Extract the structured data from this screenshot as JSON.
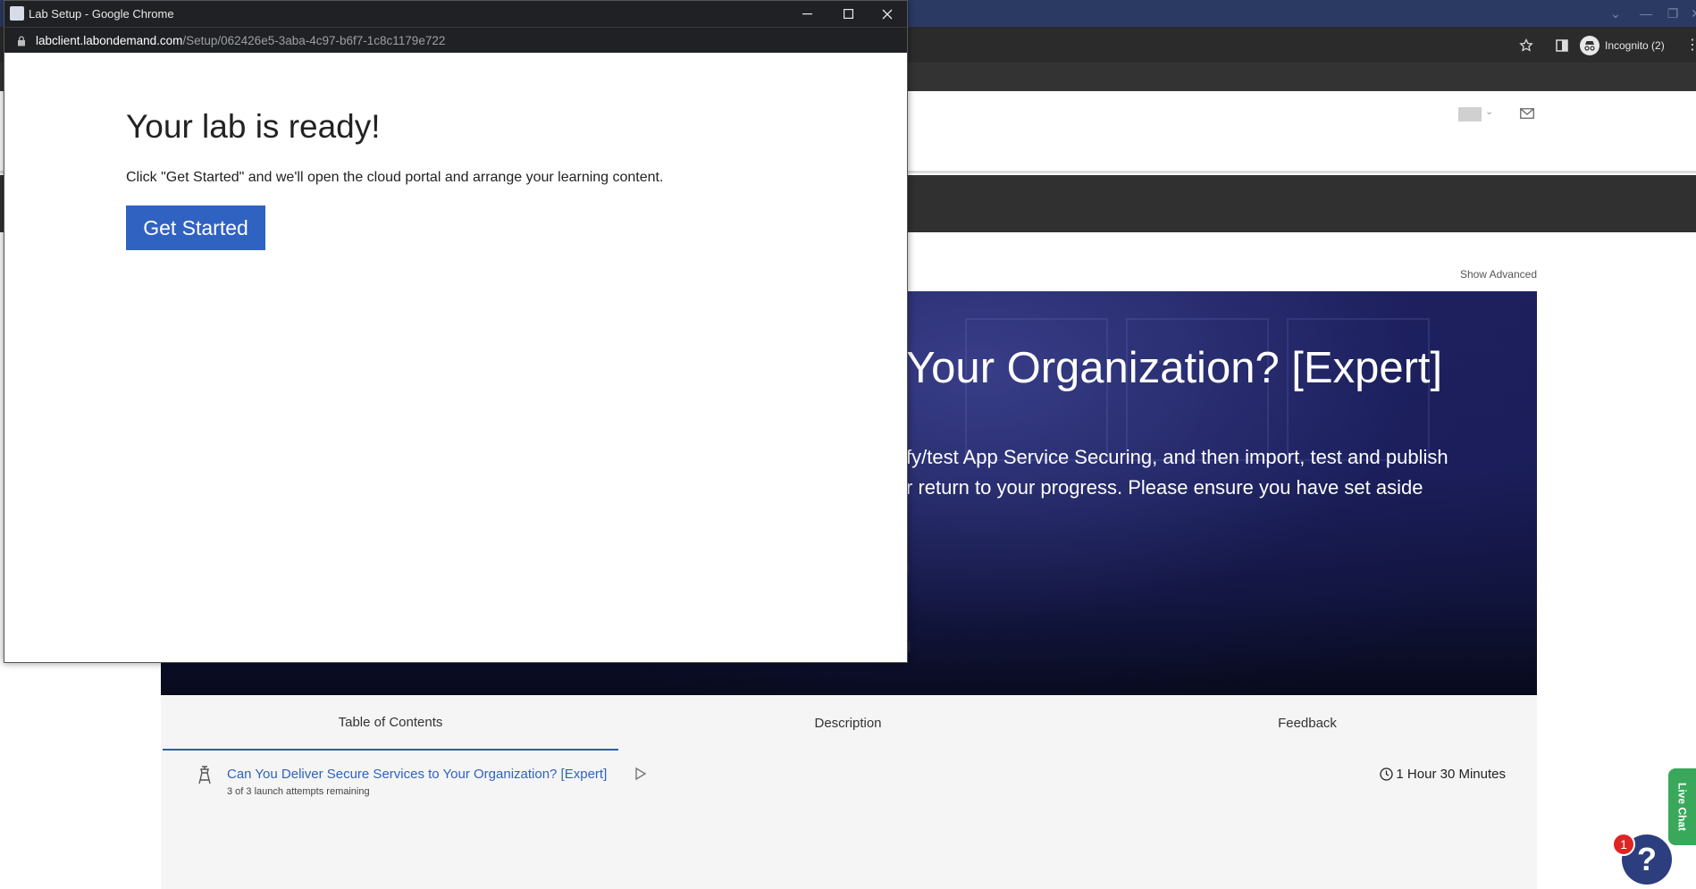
{
  "popup": {
    "window_title": "Lab Setup - Google Chrome",
    "url_host": "labclient.labondemand.com",
    "url_path": "/Setup/062426e5-3aba-4c97-b6f7-1c8c1179e722",
    "heading": "Your lab is ready!",
    "instruction": "Click \"Get Started\" and we'll open the cloud portal and arrange your learning content.",
    "get_started_label": "Get Started"
  },
  "browser": {
    "incognito_label": "Incognito (2)"
  },
  "page": {
    "show_advanced": "Show Advanced",
    "hero": {
      "title": "Your Organization? [Expert]",
      "description_line1": "fy/test App Service Securing, and then import, test and publish",
      "description_line2": "r return to your progress. Please ensure you have set aside",
      "watermark": "soft"
    },
    "tabs": [
      "Table of Contents",
      "Description",
      "Feedback"
    ],
    "lab": {
      "title": "Can You Deliver Secure Services to Your Organization? [Expert]",
      "attempts": "3 of 3 launch attempts remaining",
      "duration": "1 Hour 30 Minutes"
    },
    "live_chat_label": "Live Chat",
    "help_label": "?",
    "notification_count": "1"
  },
  "colors": {
    "accent_blue": "#3062c2",
    "link_blue": "#2f62c0",
    "hero_bg": "#1a1d58",
    "live_chat_green": "#3aa85a",
    "badge_red": "#e02424"
  }
}
